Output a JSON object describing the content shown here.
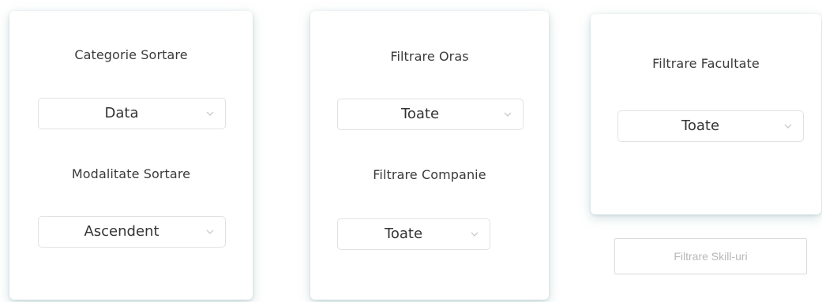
{
  "sort_card": {
    "category_heading": "Categorie Sortare",
    "category_value": "Data",
    "mode_heading": "Modalitate Sortare",
    "mode_value": "Ascendent"
  },
  "location_card": {
    "city_heading": "Filtrare Oras",
    "city_value": "Toate",
    "company_heading": "Filtrare Companie",
    "company_value": "Toate"
  },
  "faculty_card": {
    "faculty_heading": "Filtrare Facultate",
    "faculty_value": "Toate"
  },
  "skills_filter": {
    "placeholder": "Filtrare Skill-uri"
  },
  "icons": {
    "dropdown": "chevron-down-icon"
  },
  "colors": {
    "card_shadow": "#78a0a5",
    "select_border": "#e2e2e2",
    "chevron": "#c4c4c4"
  }
}
